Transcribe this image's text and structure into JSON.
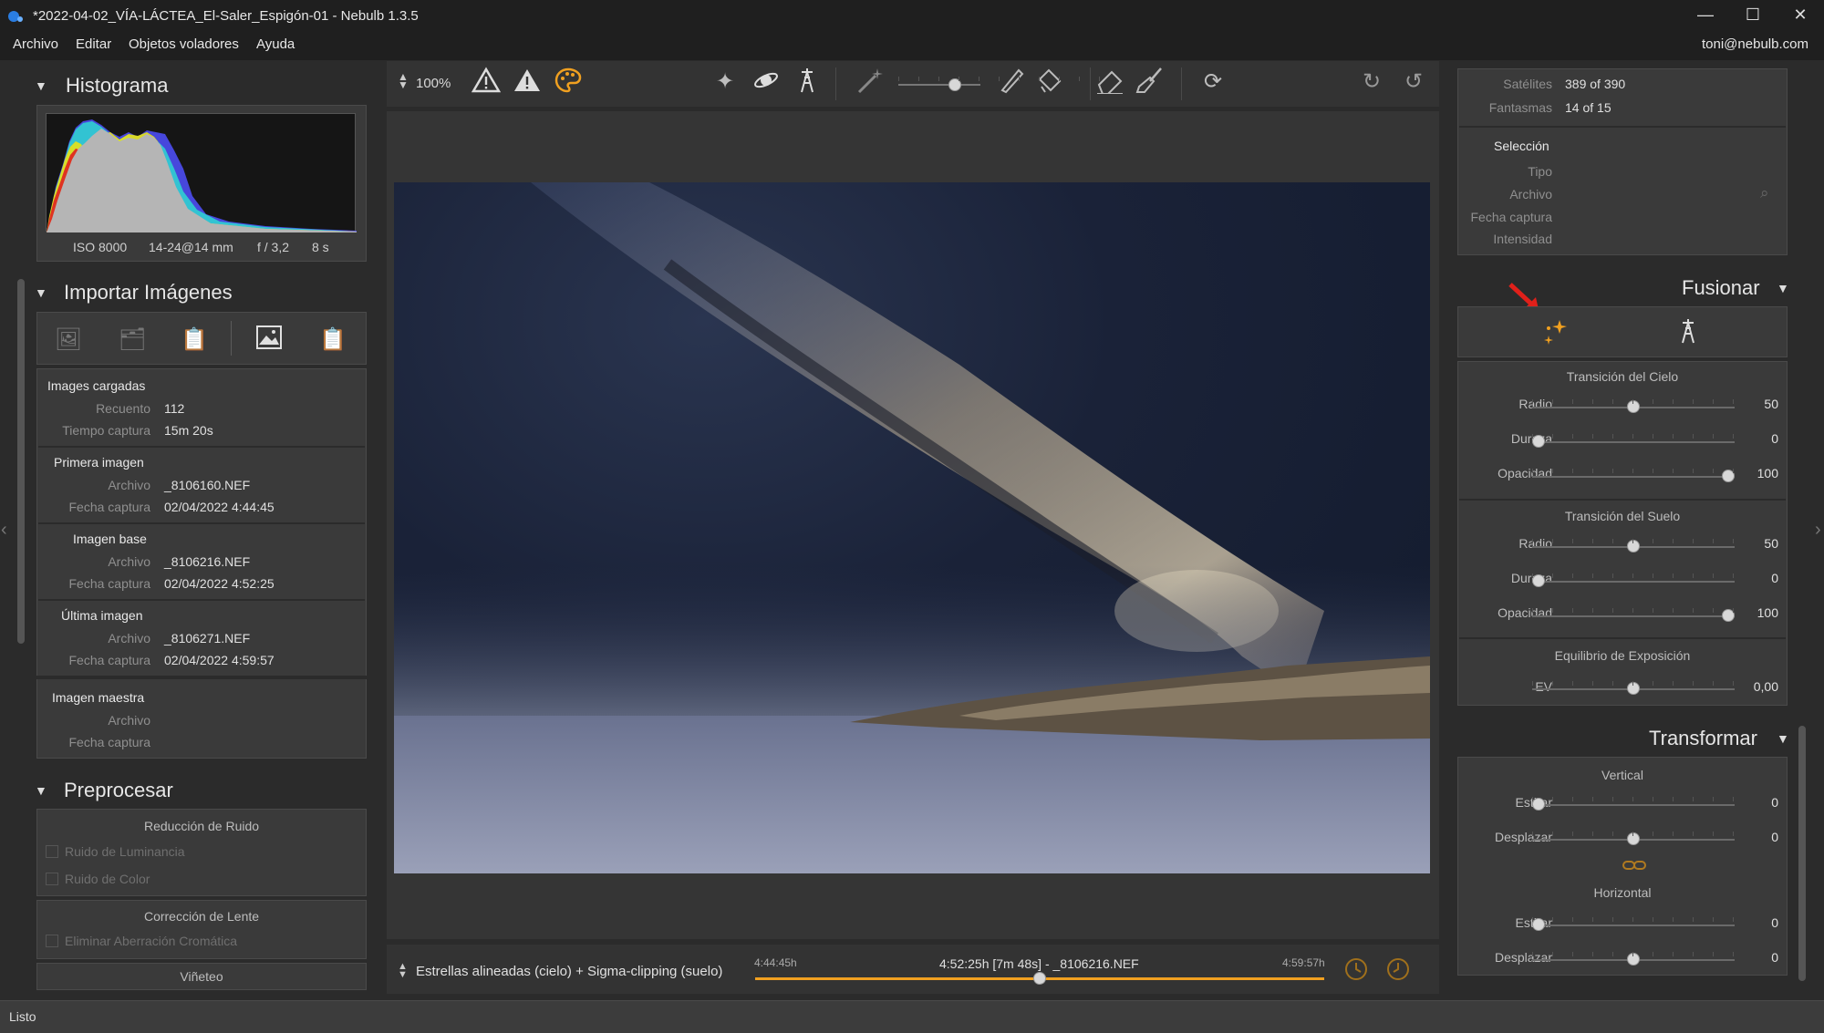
{
  "window": {
    "title": "*2022-04-02_VÍA-LÁCTEA_El-Saler_Espigón-01 - Nebulb 1.3.5",
    "minimize": "—",
    "maximize": "☐",
    "close": "✕"
  },
  "menu": {
    "items": [
      "Archivo",
      "Editar",
      "Objetos voladores",
      "Ayuda"
    ],
    "user": "toni@nebulb.com"
  },
  "colors": {
    "accent": "#f0a020",
    "panel_bg": "#3a3a3a",
    "app_bg": "#2b2b2b",
    "arrow": "#e0201a"
  },
  "histogram": {
    "title": "Histograma",
    "iso": "ISO 8000",
    "lens": "14-24@14 mm",
    "aperture": "f / 3,2",
    "exposure": "8 s"
  },
  "import": {
    "title": "Importar Imágenes",
    "loaded_header": "Images cargadas",
    "count_label": "Recuento",
    "count_value": "112",
    "time_label": "Tiempo captura",
    "time_value": "15m 20s",
    "first_header": "Primera imagen",
    "file_label": "Archivo",
    "date_label": "Fecha captura",
    "first_file": "_8106160.NEF",
    "first_date": "02/04/2022 4:44:45",
    "base_header": "Imagen base",
    "base_file": "_8106216.NEF",
    "base_date": "02/04/2022 4:52:25",
    "last_header": "Última imagen",
    "last_file": "_8106271.NEF",
    "last_date": "02/04/2022 4:59:57",
    "master_header": "Imagen maestra",
    "master_file_label": "Archivo",
    "master_date_label": "Fecha captura"
  },
  "preprocess": {
    "title": "Preprocesar",
    "noise_title": "Reducción de Ruido",
    "luminance": "Ruido de Luminancia",
    "color": "Ruido de Color",
    "lens_title": "Corrección de Lente",
    "chromatic": "Eliminar Aberración Cromática",
    "vignette": "Viñeteo"
  },
  "toolbar": {
    "zoom": "100%"
  },
  "status_bar": {
    "mode": "Estrellas alineadas (cielo) + Sigma-clipping (suelo)",
    "start_time": "4:44:45h",
    "center_label": "4:52:25h [7m 48s] - _8106216.NEF",
    "end_time": "4:59:57h",
    "timeline_position": 0.5
  },
  "info": {
    "satellites_label": "Satélites",
    "satellites_value": "389 of 390",
    "ghosts_label": "Fantasmas",
    "ghosts_value": "14 of 15",
    "selection_header": "Selección",
    "type_label": "Tipo",
    "file_label": "Archivo",
    "date_label": "Fecha captura",
    "intensity_label": "Intensidad"
  },
  "merge": {
    "title": "Fusionar",
    "sky_title": "Transición del Cielo",
    "ground_title": "Transición del Suelo",
    "exposure_title": "Equilibrio de Exposición",
    "radius_label": "Radio",
    "hardness_label": "Dureza",
    "opacity_label": "Opacidad",
    "ev_label": "EV",
    "sky_radius": "50",
    "sky_hardness": "0",
    "sky_opacity": "100",
    "ground_radius": "50",
    "ground_hardness": "0",
    "ground_opacity": "100",
    "ev_value": "0,00",
    "sky_radius_level": 0.5,
    "sky_hardness_level": 0,
    "sky_opacity_level": 1,
    "ground_radius_level": 0.5,
    "ground_hardness_level": 0,
    "ground_opacity_level": 1,
    "ev_level": 0.5
  },
  "transform": {
    "title": "Transformar",
    "vertical_title": "Vertical",
    "horizontal_title": "Horizontal",
    "stretch_label": "Estirar",
    "shift_label": "Desplazar",
    "v_stretch": "0",
    "v_shift": "0",
    "h_stretch": "0",
    "h_shift": "0",
    "v_stretch_level": 0,
    "v_shift_level": 0.5,
    "h_stretch_level": 0,
    "h_shift_level": 0.5
  },
  "statusline": {
    "text": "Listo"
  }
}
